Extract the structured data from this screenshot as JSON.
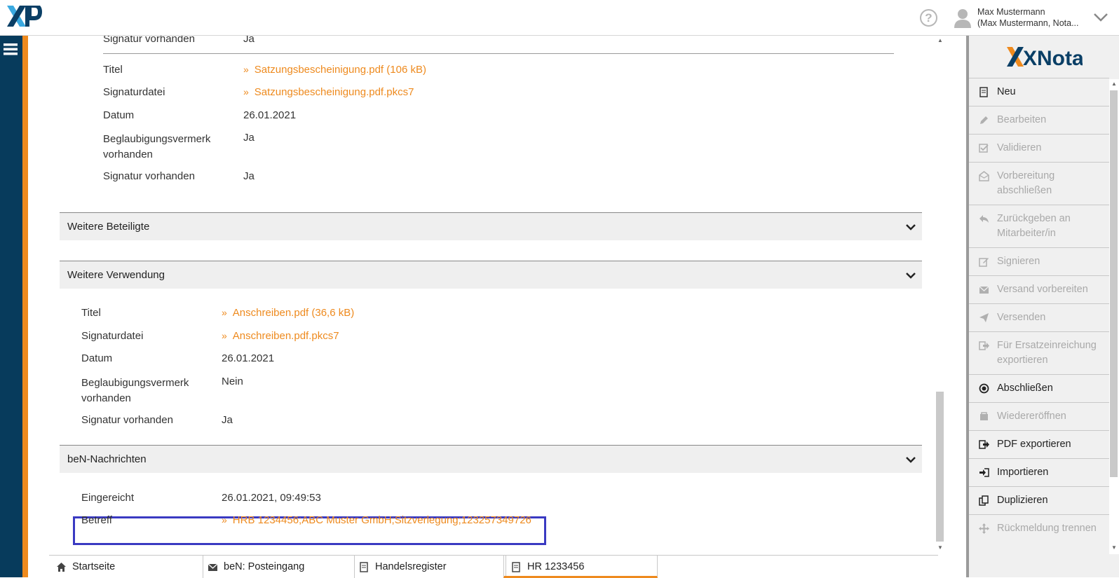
{
  "header": {
    "logo_text": "XNP",
    "help_glyph": "?",
    "user_line1": "Max Mustermann",
    "user_line2": "(Max Mustermann, Nota..."
  },
  "document_upper": {
    "signatur_vorhanden_top_label": "Signatur vorhanden",
    "signatur_vorhanden_top_value": "Ja",
    "rows": [
      {
        "label": "Titel",
        "value": "Satzungsbescheinigung.pdf (106 kB)",
        "link": true
      },
      {
        "label": "Signaturdatei",
        "value": "Satzungsbescheinigung.pdf.pkcs7",
        "link": true
      },
      {
        "label": "Datum",
        "value": "26.01.2021",
        "link": false
      },
      {
        "label": "Beglaubigungsvermerk vorhanden",
        "value": "Ja",
        "link": false
      },
      {
        "label": "Signatur vorhanden",
        "value": "Ja",
        "link": false
      }
    ]
  },
  "sections": {
    "weitere_beteiligte": "Weitere Beteiligte",
    "weitere_verwendung": "Weitere Verwendung",
    "ben_nachrichten": "beN-Nachrichten"
  },
  "weitere_verwendung": {
    "rows": [
      {
        "label": "Titel",
        "value": "Anschreiben.pdf (36,6 kB)",
        "link": true
      },
      {
        "label": "Signaturdatei",
        "value": "Anschreiben.pdf.pkcs7",
        "link": true
      },
      {
        "label": "Datum",
        "value": "26.01.2021",
        "link": false
      },
      {
        "label": "Beglaubigungsvermerk vorhanden",
        "value": "Nein",
        "link": false
      },
      {
        "label": "Signatur vorhanden",
        "value": "Ja",
        "link": false
      }
    ]
  },
  "ben_nachrichten": {
    "eingereicht_label": "Eingereicht",
    "eingereicht_value": "26.01.2021, 09:49:53",
    "betreff_label": "Betreff",
    "betreff_value": "HRB 1234456;ABC Muster GmbH;Sitzverlegung;123257349726"
  },
  "right_panel": {
    "logo_text": "XNotar",
    "menu": [
      {
        "label": "Neu",
        "enabled": true,
        "icon": "new-doc-icon"
      },
      {
        "label": "Bearbeiten",
        "enabled": false,
        "icon": "pencil-icon"
      },
      {
        "label": "Validieren",
        "enabled": false,
        "icon": "check-box-icon"
      },
      {
        "label": "Vorbereitung abschließen",
        "enabled": false,
        "icon": "envelope-open-icon"
      },
      {
        "label": "Zurückgeben an Mitarbeiter/in",
        "enabled": false,
        "icon": "reply-icon"
      },
      {
        "label": "Signieren",
        "enabled": false,
        "icon": "edit-icon"
      },
      {
        "label": "Versand vorbereiten",
        "enabled": false,
        "icon": "envelope-icon"
      },
      {
        "label": "Versenden",
        "enabled": false,
        "icon": "send-icon"
      },
      {
        "label": "Für Ersatzeinreichung exportieren",
        "enabled": false,
        "icon": "export-icon"
      },
      {
        "label": "Abschließen",
        "enabled": true,
        "icon": "target-icon"
      },
      {
        "label": "Wiedereröffnen",
        "enabled": false,
        "icon": "reopen-icon"
      },
      {
        "label": "PDF exportieren",
        "enabled": true,
        "icon": "export-icon"
      },
      {
        "label": "Importieren",
        "enabled": true,
        "icon": "import-icon"
      },
      {
        "label": "Duplizieren",
        "enabled": true,
        "icon": "duplicate-icon"
      },
      {
        "label": "Rückmeldung trennen",
        "enabled": false,
        "icon": "move-icon"
      }
    ]
  },
  "tabs": [
    {
      "label": "Startseite",
      "icon": "home-icon"
    },
    {
      "label": "beN: Posteingang",
      "icon": "envelope-icon"
    },
    {
      "label": "Handelsregister",
      "icon": "doc-icon"
    },
    {
      "label": "HR 1233456",
      "icon": "doc-icon",
      "active": true
    }
  ],
  "colors": {
    "accent": "#ee8a1e",
    "sidebar": "#073b5c",
    "highlight_border": "#3a3ac2"
  }
}
